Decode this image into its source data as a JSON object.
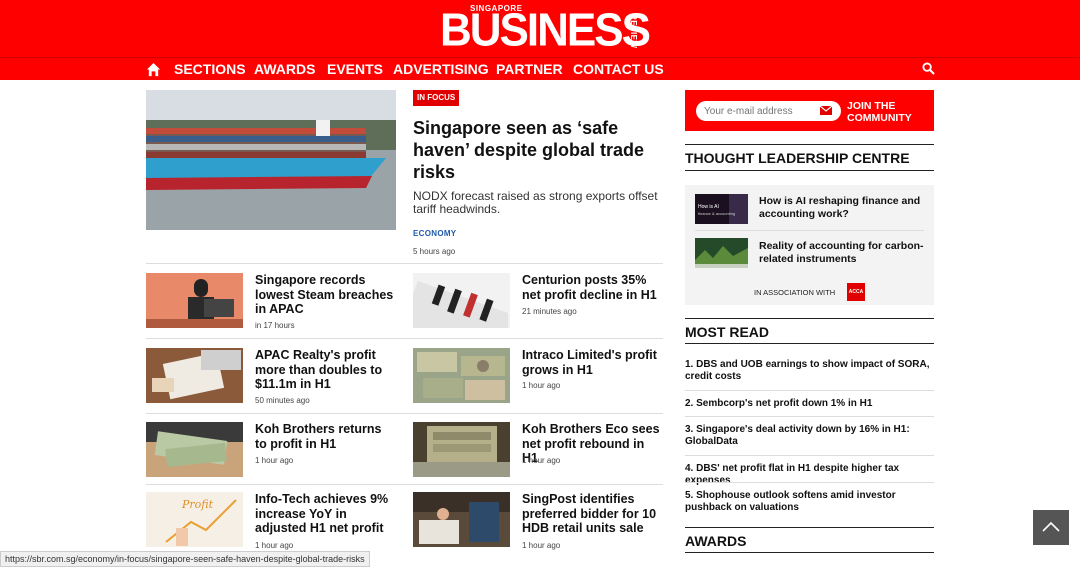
{
  "brand": {
    "top_small": "SINGAPORE",
    "name": "BUSINESS",
    "side_small": "REVIEW",
    "color": "#ff0000"
  },
  "nav": {
    "items": [
      "SECTIONS",
      "AWARDS",
      "EVENTS",
      "ADVERTISING",
      "PARTNER",
      "CONTACT US"
    ]
  },
  "hero": {
    "tag": "IN FOCUS",
    "title": "Singapore seen as ‘safe haven’ despite global trade risks",
    "subtitle": "NODX forecast raised as strong exports offset tariff headwinds.",
    "category": "ECONOMY",
    "time": "5 hours ago"
  },
  "articles": [
    {
      "title": "Singapore records lowest Steam breaches in APAC",
      "time": "in 17 hours"
    },
    {
      "title": "Centurion posts 35% net profit decline in H1",
      "time": "21 minutes ago"
    },
    {
      "title": "APAC Realty's profit more than doubles to $11.1m in H1",
      "time": "50 minutes ago"
    },
    {
      "title": "Intraco Limited's profit grows in H1",
      "time": "1 hour ago"
    },
    {
      "title": "Koh Brothers returns to profit in H1",
      "time": "1 hour ago"
    },
    {
      "title": "Koh Brothers Eco sees net profit rebound in H1",
      "time": "1 hour ago"
    },
    {
      "title": "Info-Tech achieves 9% increase YoY in adjusted H1 net profit",
      "time": "1 hour ago"
    },
    {
      "title": "SingPost identifies preferred bidder for 10 HDB retail units sale",
      "time": "1 hour ago"
    }
  ],
  "newsletter": {
    "placeholder": "Your e-mail address",
    "join_line1": "JOIN THE",
    "join_line2": "COMMUNITY"
  },
  "thought_leadership": {
    "heading": "THOUGHT LEADERSHIP CENTRE",
    "items": [
      {
        "title": "How is AI reshaping finance and accounting work?"
      },
      {
        "title": "Reality of accounting for carbon-related instruments"
      }
    ],
    "association": "IN ASSOCIATION WITH",
    "partner": "ACCA"
  },
  "most_read": {
    "heading": "MOST READ",
    "items": [
      "1. DBS and UOB earnings to show impact of SORA, credit costs",
      "2. Sembcorp's net profit down 1% in H1",
      "3. Singapore's deal activity down by 16% in H1: GlobalData",
      "4. DBS' net profit flat in H1 despite higher tax expenses",
      "5. Shophouse outlook softens amid investor pushback on valuations"
    ]
  },
  "awards": {
    "heading": "AWARDS"
  },
  "status_url": "https://sbr.com.sg/economy/in-focus/singapore-seen-safe-haven-despite-global-trade-risks"
}
